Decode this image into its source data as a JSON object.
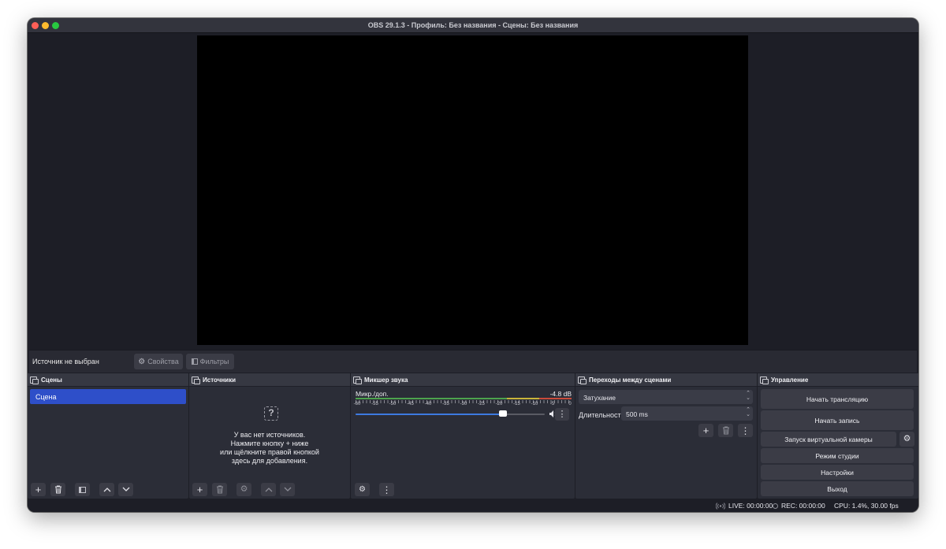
{
  "window": {
    "title": "OBS 29.1.3 - Профиль: Без названия - Сцены: Без названия"
  },
  "source_toolbar": {
    "status": "Источник не выбран",
    "properties_label": "Свойства",
    "filters_label": "Фильтры"
  },
  "scenes_dock": {
    "title": "Сцены",
    "items": [
      "Сцена"
    ]
  },
  "sources_dock": {
    "title": "Источники",
    "empty_lines": [
      "У вас нет источников.",
      "Нажмите кнопку + ниже",
      "или щёлкните правой кнопкой",
      "здесь для добавления."
    ]
  },
  "mixer_dock": {
    "title": "Микшер звука",
    "channel_name": "Микр./доп.",
    "level": "-4.8 dB",
    "scale_labels": [
      "-60",
      "-55",
      "-50",
      "-45",
      "-40",
      "-35",
      "-30",
      "-25",
      "-20",
      "-15",
      "-10",
      "-5",
      "0"
    ],
    "volume_fraction": 0.78
  },
  "transitions_dock": {
    "title": "Переходы между сценами",
    "transition": "Затухание",
    "duration_label": "Длительность",
    "duration_value": "500 ms"
  },
  "controls_dock": {
    "title": "Управление",
    "start_stream": "Начать трансляцию",
    "start_record": "Начать запись",
    "virtual_camera": "Запуск виртуальной камеры",
    "studio_mode": "Режим студии",
    "settings": "Настройки",
    "exit": "Выход"
  },
  "status_bar": {
    "live": "LIVE: 00:00:00",
    "rec": "REC: 00:00:00",
    "cpu": "CPU: 1.4%, 30.00 fps"
  },
  "colors": {
    "accent": "#2e4fc9",
    "window_bg": "#1d1e26",
    "dock_bg": "#2b2d37",
    "slider": "#3d7ae0"
  }
}
